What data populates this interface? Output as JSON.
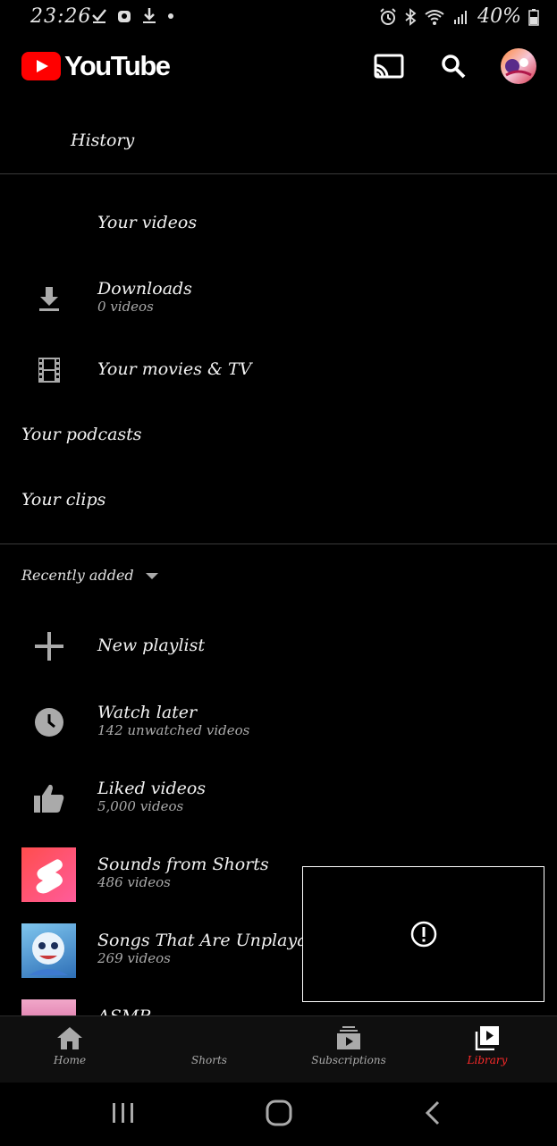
{
  "status": {
    "time": "23:26",
    "battery": "40%"
  },
  "header": {
    "logo_text": "YouTube",
    "icons": [
      "cast-icon",
      "search-icon",
      "avatar"
    ]
  },
  "sections": {
    "history": "History",
    "your_videos": "Your videos",
    "downloads": {
      "title": "Downloads",
      "sub": "0 videos"
    },
    "movies": "Your movies & TV",
    "podcasts": "Your podcasts",
    "clips": "Your clips"
  },
  "playlists": {
    "sort_label": "Recently added",
    "new_playlist": "New playlist",
    "items": [
      {
        "title": "Watch later",
        "sub": "142 unwatched videos"
      },
      {
        "title": "Liked videos",
        "sub": "5,000 videos"
      },
      {
        "title": "Sounds from Shorts",
        "sub": "486 videos"
      },
      {
        "title": "Songs That Are Unplayable",
        "sub": "269 videos"
      },
      {
        "title": "ASMR",
        "sub": ""
      }
    ]
  },
  "bottom_nav": {
    "home": "Home",
    "shorts": "Shorts",
    "subscriptions": "Subscriptions",
    "library": "Library"
  },
  "colors": {
    "accent": "#ff0000",
    "active_tab": "#ff2a2a",
    "background": "#000000"
  }
}
